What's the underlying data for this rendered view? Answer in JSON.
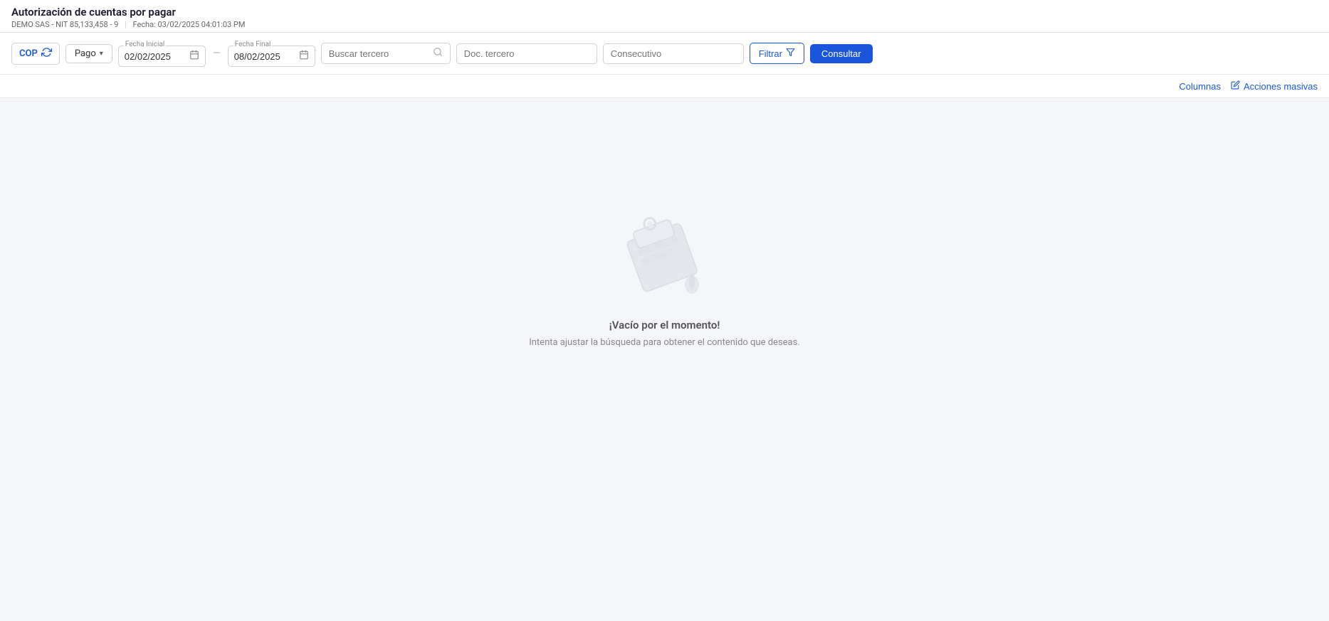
{
  "header": {
    "title": "Autorización de cuentas por pagar",
    "company": "DEMO SAS - NIT 85,133,458 - 9",
    "date_label": "Fecha:",
    "date_value": "03/02/2025 04:01:03 PM"
  },
  "toolbar": {
    "currency": "COP",
    "pago_label": "Pago",
    "fecha_inicial_label": "Fecha Inicial",
    "fecha_inicial_value": "02/02/2025",
    "fecha_final_label": "Fecha Final",
    "fecha_final_value": "08/02/2025",
    "buscar_tercero_placeholder": "Buscar tercero",
    "doc_tercero_placeholder": "Doc. tercero",
    "consecutivo_placeholder": "Consecutivo",
    "filtrar_label": "Filtrar",
    "consultar_label": "Consultar"
  },
  "action_bar": {
    "columnas_label": "Columnas",
    "acciones_label": "Acciones masivas"
  },
  "empty_state": {
    "title": "¡Vacío por el momento!",
    "subtitle": "Intenta ajustar la búsqueda para obtener el contenido que deseas."
  }
}
